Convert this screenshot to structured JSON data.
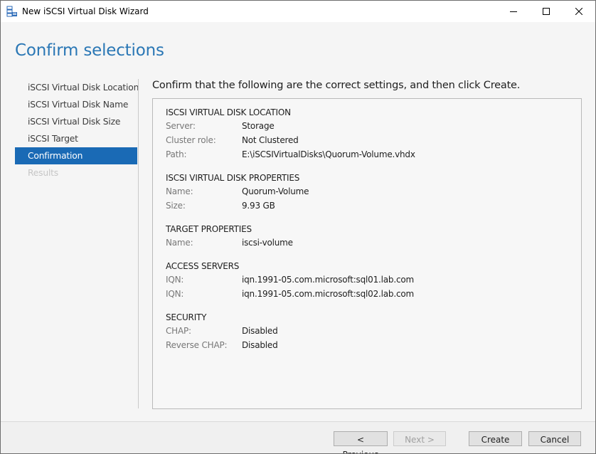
{
  "window": {
    "title": "New iSCSI Virtual Disk Wizard",
    "controls": {
      "minimize": "minimize-icon",
      "maximize": "maximize-icon",
      "close": "close-icon"
    }
  },
  "page": {
    "title": "Confirm selections",
    "instruction": "Confirm that the following are the correct settings, and then click Create."
  },
  "nav": {
    "items": [
      {
        "label": "iSCSI Virtual Disk Location",
        "state": "normal"
      },
      {
        "label": "iSCSI Virtual Disk Name",
        "state": "normal"
      },
      {
        "label": "iSCSI Virtual Disk Size",
        "state": "normal"
      },
      {
        "label": "iSCSI Target",
        "state": "normal"
      },
      {
        "label": "Confirmation",
        "state": "active"
      },
      {
        "label": "Results",
        "state": "disabled"
      }
    ]
  },
  "summary": {
    "sections": [
      {
        "heading": "ISCSI VIRTUAL DISK LOCATION",
        "rows": [
          {
            "key": "Server:",
            "value": "Storage"
          },
          {
            "key": "Cluster role:",
            "value": "Not Clustered"
          },
          {
            "key": "Path:",
            "value": "E:\\iSCSIVirtualDisks\\Quorum-Volume.vhdx"
          }
        ]
      },
      {
        "heading": "ISCSI VIRTUAL DISK PROPERTIES",
        "rows": [
          {
            "key": "Name:",
            "value": "Quorum-Volume"
          },
          {
            "key": "Size:",
            "value": "9.93 GB"
          }
        ]
      },
      {
        "heading": "TARGET PROPERTIES",
        "rows": [
          {
            "key": "Name:",
            "value": "iscsi-volume"
          }
        ]
      },
      {
        "heading": "ACCESS SERVERS",
        "rows": [
          {
            "key": "IQN:",
            "value": "iqn.1991-05.com.microsoft:sql01.lab.com"
          },
          {
            "key": "IQN:",
            "value": "iqn.1991-05.com.microsoft:sql02.lab.com"
          }
        ]
      },
      {
        "heading": "SECURITY",
        "rows": [
          {
            "key": "CHAP:",
            "value": "Disabled"
          },
          {
            "key": "Reverse CHAP:",
            "value": "Disabled"
          }
        ]
      }
    ]
  },
  "footer": {
    "previous_label": "< Previous",
    "next_label": "Next >",
    "next_enabled": false,
    "create_label": "Create",
    "cancel_label": "Cancel"
  },
  "colors": {
    "accent": "#1a6ab5",
    "title": "#2a77b5"
  }
}
